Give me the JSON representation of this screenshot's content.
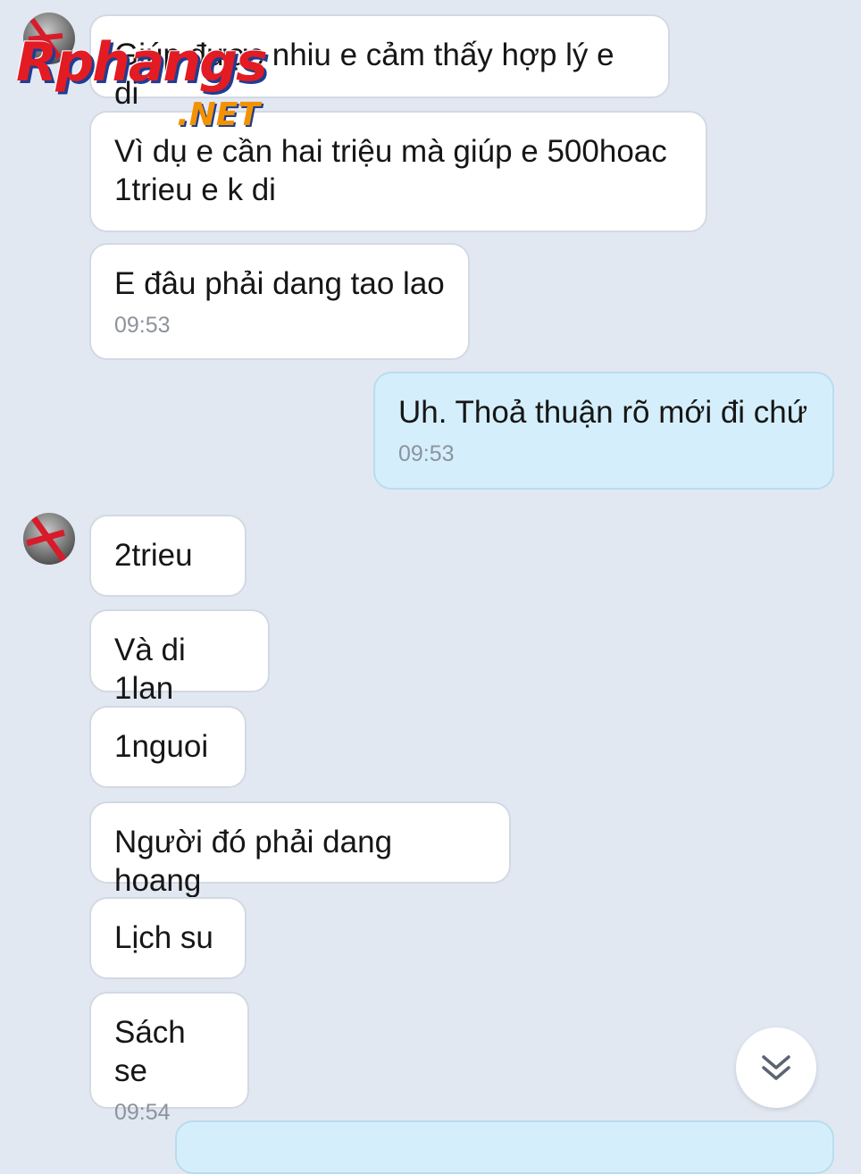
{
  "watermark": {
    "logo": "Rphangs",
    "suffix": ".NET"
  },
  "messages": [
    {
      "text": "Giúp được nhiu e cảm thấy hợp lý e di",
      "time": ""
    },
    {
      "text": "Vì dụ e cần hai triệu mà giúp e 500hoac 1trieu e k di",
      "time": ""
    },
    {
      "text": "E đâu phải dang tao lao",
      "time": "09:53"
    },
    {
      "text": "Uh. Thoả thuận rõ mới đi chứ",
      "time": "09:53"
    },
    {
      "text": "2trieu",
      "time": ""
    },
    {
      "text": "Và di 1lan",
      "time": ""
    },
    {
      "text": "1nguoi",
      "time": ""
    },
    {
      "text": "Người đó phải dang hoang",
      "time": ""
    },
    {
      "text": "Lịch su",
      "time": ""
    },
    {
      "text": "Sách se",
      "time": "09:54"
    }
  ],
  "icons": {
    "scroll_down": "chevron-double-down-icon",
    "avatar": "contact-avatar"
  },
  "colors": {
    "background": "#e2e8f2",
    "incoming_bubble": "#ffffff",
    "outgoing_bubble": "#d4effb",
    "time": "#8d939c"
  }
}
